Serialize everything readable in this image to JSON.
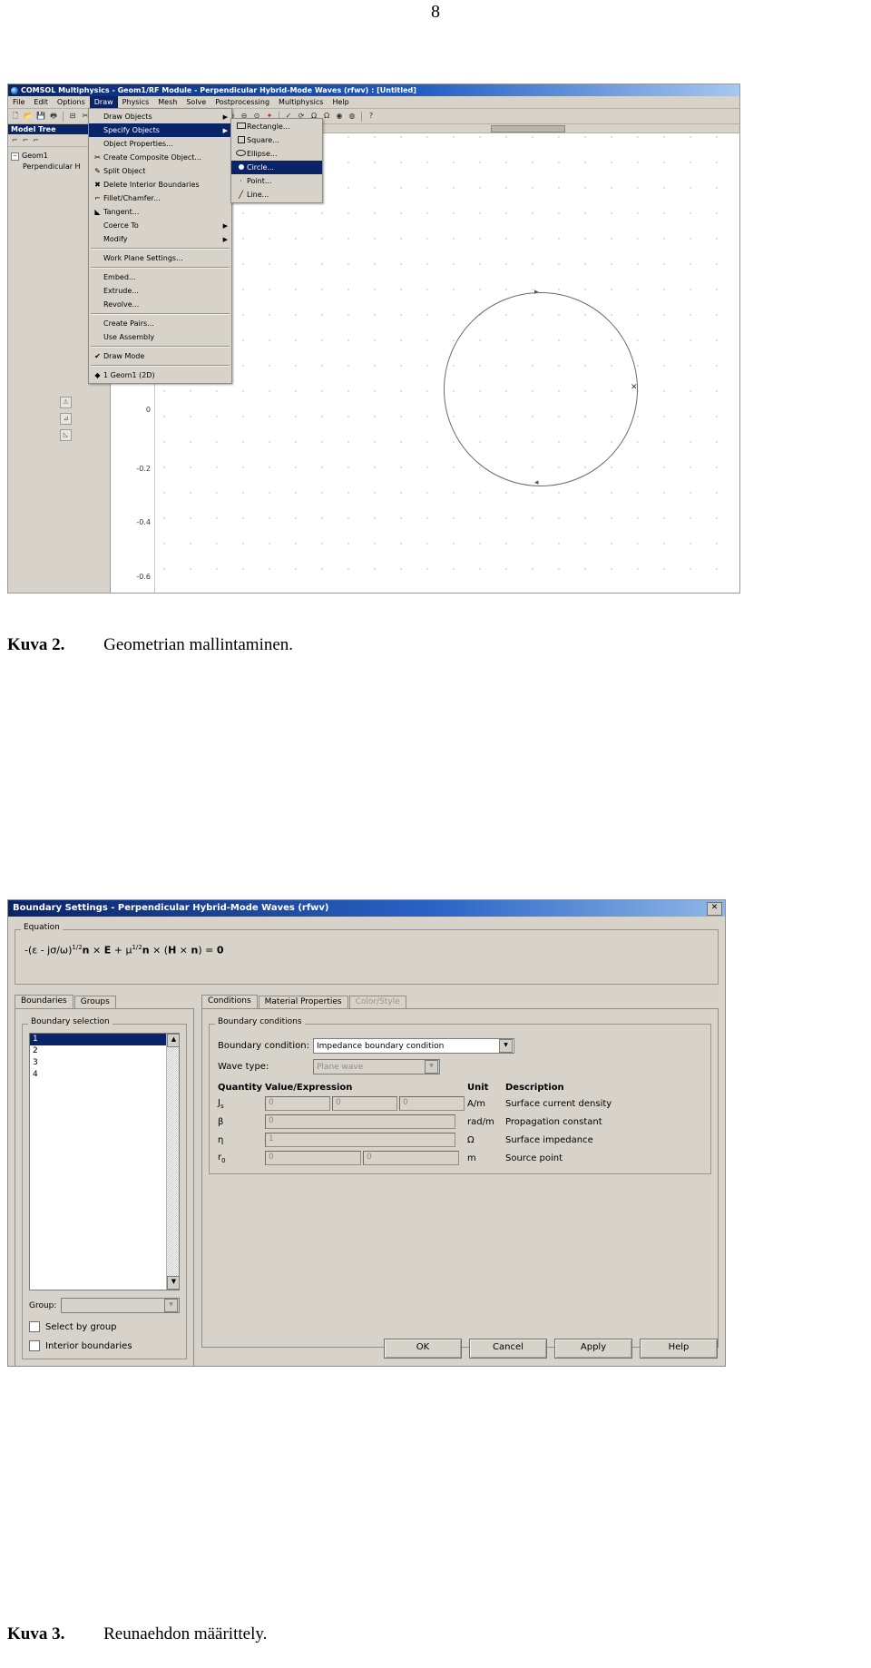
{
  "page": {
    "number": "8"
  },
  "figure1": {
    "window_title": "COMSOL Multiphysics - Geom1/RF Module - Perpendicular Hybrid-Mode Waves (rfwv) : [Untitled]",
    "menubar": [
      "File",
      "Edit",
      "Options",
      "Draw",
      "Physics",
      "Mesh",
      "Solve",
      "Postprocessing",
      "Multiphysics",
      "Help"
    ],
    "active_menu": "Draw",
    "model_tree": {
      "header": "Model Tree",
      "root": "Geom1",
      "child": "Perpendicular H"
    },
    "draw_menu": [
      {
        "label": "Draw Objects",
        "icon": "",
        "submenu": true,
        "selected": false,
        "sep_after": false
      },
      {
        "label": "Specify Objects",
        "icon": "",
        "submenu": true,
        "selected": true,
        "sep_after": false
      },
      {
        "label": "Object Properties...",
        "icon": "",
        "submenu": false,
        "selected": false,
        "sep_after": false
      },
      {
        "label": "Create Composite Object...",
        "icon": "composite-icon",
        "submenu": false,
        "selected": false,
        "sep_after": false
      },
      {
        "label": "Split Object",
        "icon": "split-icon",
        "submenu": false,
        "selected": false,
        "sep_after": false
      },
      {
        "label": "Delete Interior Boundaries",
        "icon": "delete-icon",
        "submenu": false,
        "selected": false,
        "sep_after": false
      },
      {
        "label": "Fillet/Chamfer...",
        "icon": "fillet-icon",
        "submenu": false,
        "selected": false,
        "sep_after": false
      },
      {
        "label": "Tangent...",
        "icon": "tangent-icon",
        "submenu": false,
        "selected": false,
        "sep_after": false
      },
      {
        "label": "Coerce To",
        "icon": "",
        "submenu": true,
        "selected": false,
        "sep_after": false
      },
      {
        "label": "Modify",
        "icon": "",
        "submenu": true,
        "selected": false,
        "sep_after": true
      },
      {
        "label": "Work Plane Settings...",
        "icon": "",
        "submenu": false,
        "selected": false,
        "sep_after": true
      },
      {
        "label": "Embed...",
        "icon": "",
        "submenu": false,
        "selected": false,
        "sep_after": false
      },
      {
        "label": "Extrude...",
        "icon": "",
        "submenu": false,
        "selected": false,
        "sep_after": false
      },
      {
        "label": "Revolve...",
        "icon": "",
        "submenu": false,
        "selected": false,
        "sep_after": true
      },
      {
        "label": "Create Pairs...",
        "icon": "",
        "submenu": false,
        "selected": false,
        "sep_after": false
      },
      {
        "label": "Use Assembly",
        "icon": "",
        "submenu": false,
        "selected": false,
        "sep_after": true
      },
      {
        "label": "Draw Mode",
        "icon": "check-icon",
        "submenu": false,
        "selected": false,
        "sep_after": true
      },
      {
        "label": "1 Geom1 (2D)",
        "icon": "bullet-icon",
        "submenu": false,
        "selected": false,
        "sep_after": false
      }
    ],
    "specify_submenu": [
      {
        "label": "Rectangle...",
        "icon": "rectangle-icon",
        "selected": false
      },
      {
        "label": "Square...",
        "icon": "square-icon",
        "selected": false
      },
      {
        "label": "Ellipse...",
        "icon": "ellipse-icon",
        "selected": false
      },
      {
        "label": "Circle...",
        "icon": "circle-icon",
        "selected": true
      },
      {
        "label": "Point...",
        "icon": "point-icon",
        "selected": false
      },
      {
        "label": "Line...",
        "icon": "line-icon",
        "selected": false
      }
    ],
    "axis_ticks": [
      "0",
      "-0.2",
      "-0.4",
      "-0.6"
    ]
  },
  "caption1": {
    "lead": "Kuva 2.",
    "text": "Geometrian mallintaminen."
  },
  "figure2": {
    "title": "Boundary Settings - Perpendicular Hybrid-Mode Waves (rfwv)",
    "close_label": "✕",
    "equation_group": "Equation",
    "equation_html": "-(ε - jσ/ω)<sup>1/2</sup><b>n</b> × <b>E</b> + μ<sup>1/2</sup><b>n</b> × (<b>H</b> × <b>n</b>) = <b>0</b>",
    "left_tabs": [
      {
        "label": "Boundaries",
        "active": true,
        "disabled": false
      },
      {
        "label": "Groups",
        "active": false,
        "disabled": false
      }
    ],
    "right_tabs": [
      {
        "label": "Conditions",
        "active": true,
        "disabled": false
      },
      {
        "label": "Material Properties",
        "active": false,
        "disabled": false
      },
      {
        "label": "Color/Style",
        "active": false,
        "disabled": true
      }
    ],
    "boundary_selection": {
      "legend": "Boundary selection",
      "items": [
        "1",
        "2",
        "3",
        "4"
      ],
      "selected_index": 0,
      "group_label": "Group:",
      "group_value": "",
      "select_by_group": "Select by group",
      "interior_boundaries": "Interior boundaries"
    },
    "boundary_conditions": {
      "legend": "Boundary conditions",
      "condition_label": "Boundary condition:",
      "condition_value": "Impedance boundary condition",
      "wave_type_label": "Wave type:",
      "wave_type_value": "Plane wave",
      "headers": [
        "Quantity",
        "Value/Expression",
        "Unit",
        "Description"
      ],
      "rows": [
        {
          "quantity": "J",
          "sub": "s",
          "values": [
            "0",
            "0",
            "0"
          ],
          "unit": "A/m",
          "description": "Surface current density"
        },
        {
          "quantity": "β",
          "sub": "",
          "values": [
            "0"
          ],
          "unit": "rad/m",
          "description": "Propagation constant"
        },
        {
          "quantity": "η",
          "sub": "",
          "values": [
            "1"
          ],
          "unit": "Ω",
          "description": "Surface impedance"
        },
        {
          "quantity": "r",
          "sub": "0",
          "values": [
            "0",
            "0"
          ],
          "unit": "m",
          "description": "Source point"
        }
      ]
    },
    "buttons": [
      "OK",
      "Cancel",
      "Apply",
      "Help"
    ]
  },
  "caption2": {
    "lead": "Kuva 3.",
    "text": "Reunaehdon määrittely."
  }
}
